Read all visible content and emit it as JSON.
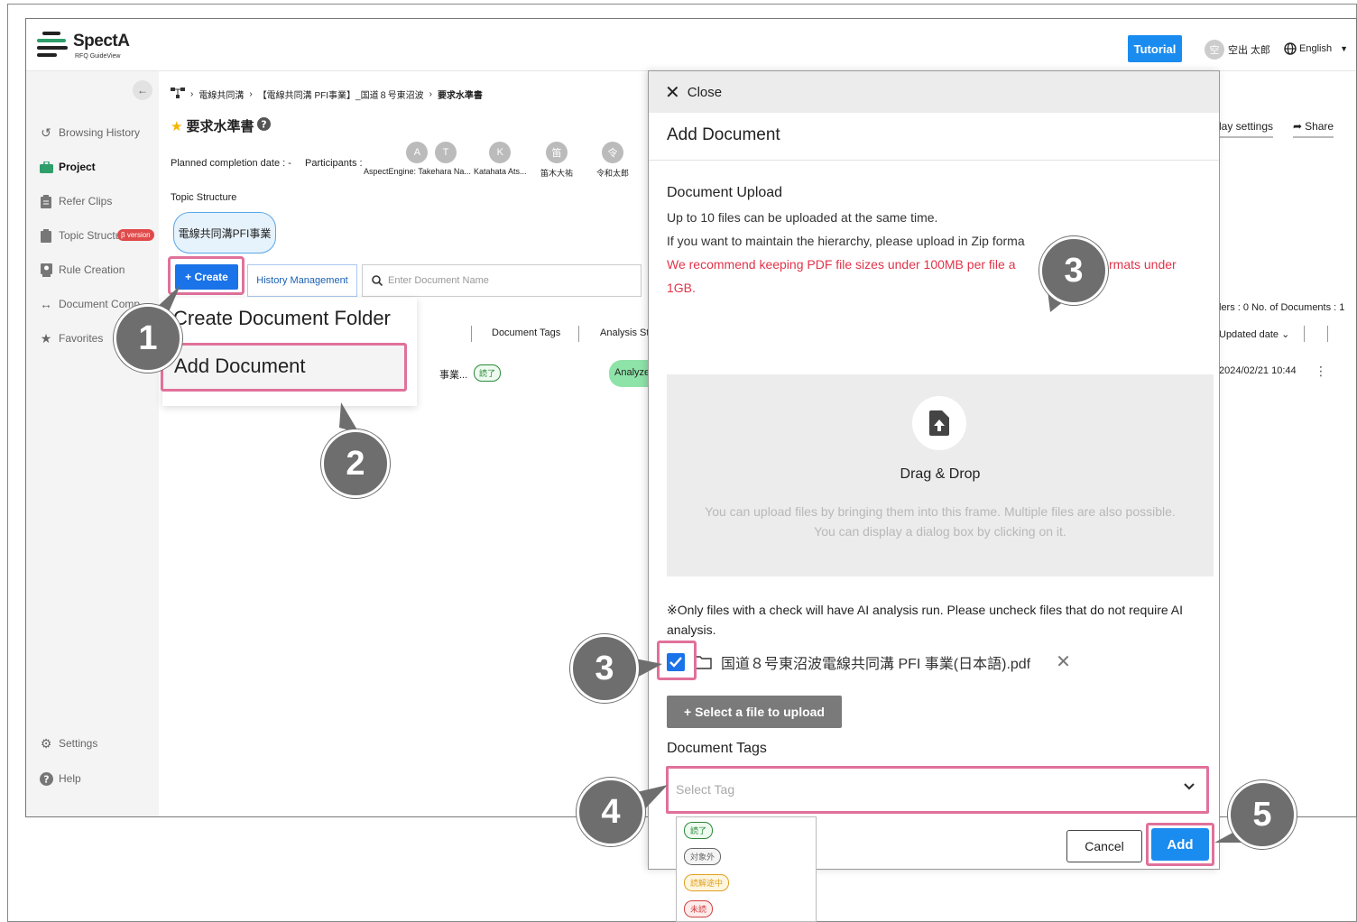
{
  "header": {
    "logo_name": "SpectA",
    "logo_sub": "RFQ GuideView",
    "tutorial": "Tutorial",
    "user_initial": "空",
    "user_name": "空出 太郎",
    "language": "English"
  },
  "sidebar": {
    "items": [
      {
        "label": "Browsing History",
        "icon": "history-icon"
      },
      {
        "label": "Project",
        "icon": "briefcase-icon"
      },
      {
        "label": "Refer Clips",
        "icon": "clipboard-icon"
      },
      {
        "label": "Topic Structure",
        "icon": "clipboard-icon"
      },
      {
        "label": "Rule Creation",
        "icon": "rule-icon"
      },
      {
        "label": "Document Comp",
        "icon": "compare-icon"
      },
      {
        "label": "Favorites",
        "icon": "star-icon"
      }
    ],
    "beta_badge": "β version",
    "settings": "Settings",
    "help": "Help"
  },
  "breadcrumb": [
    "電線共同溝",
    "【電線共同溝 PFI事業】_国道８号東沼波",
    "要求水準書"
  ],
  "page": {
    "title": "要求水準書",
    "planned_completion": "Planned completion date : -",
    "participants_label": "Participants :",
    "participants": [
      {
        "initial": "A",
        "name": "AspectEngine: Takehara Na..."
      },
      {
        "initial": "T",
        "name": ""
      },
      {
        "initial": "K",
        "name": "Katahata Ats..."
      },
      {
        "initial": "笛",
        "name": "笛木大祐"
      },
      {
        "initial": "令",
        "name": "令和太郎"
      }
    ],
    "topic_structure_label": "Topic Structure",
    "topic_pill": "電線共同溝PFI事業",
    "create_button": "+ Create",
    "history_button": "History Management",
    "search_placeholder": "Enter Document Name",
    "display_settings": "lay settings",
    "share": "Share",
    "counts": "lers : 0 No. of Documents : 1",
    "columns": {
      "tags": "Document Tags",
      "analysis": "Analysis St",
      "updated": "Updated date"
    },
    "row": {
      "name_frag": "事業...",
      "tag": "読了",
      "analysis": "Analyze",
      "updated": "2024/02/21 10:44"
    }
  },
  "create_menu": {
    "folder": "Create Document Folder",
    "add": "Add Document"
  },
  "modal": {
    "close": "Close",
    "title": "Add Document",
    "section": "Document Upload",
    "line1": "Up to 10 files can be uploaded at the same time.",
    "line2": "If you want to maintain the hierarchy, please upload in Zip forma",
    "red_note_a": "We recommend keeping PDF file sizes under 100MB per file a",
    "red_note_b": "rmats under",
    "red_note_c": "1GB.",
    "drop_title": "Drag & Drop",
    "drop_hint1": "You can upload files by bringing them into this frame. Multiple files are also possible.",
    "drop_hint2": "You can display a dialog box by clicking on it.",
    "ai_note": "※Only files with a check will have AI analysis run. Please uncheck files that do not require AI analysis.",
    "file_name": "国道８号東沼波電線共同溝 PFI 事業(日本語).pdf",
    "select_file_button": "+ Select a file to upload",
    "tags_label": "Document Tags",
    "tag_placeholder": "Select Tag",
    "tag_options": [
      {
        "label": "読了",
        "color": "#2a8a3a"
      },
      {
        "label": "対象外",
        "color": "#666666"
      },
      {
        "label": "読解途中",
        "color": "#e0a020"
      },
      {
        "label": "未読",
        "color": "#d04040"
      }
    ],
    "cancel": "Cancel",
    "add": "Add"
  },
  "callouts": [
    "1",
    "2",
    "3",
    "3",
    "4",
    "5"
  ],
  "colors": {
    "accent": "#1a8cf0",
    "highlight": "#e0719a",
    "callout": "#6e6e6e"
  }
}
